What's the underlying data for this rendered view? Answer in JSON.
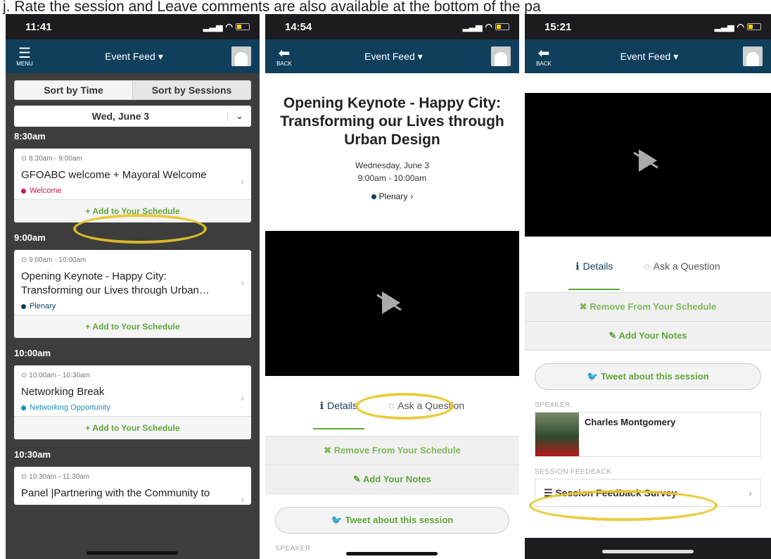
{
  "caption": "j.   Rate the session and Leave comments are also available at the bottom of the pa",
  "phone1": {
    "time": "11:41",
    "nav": {
      "left_label": "MENU",
      "title": "Event Feed"
    },
    "sort_time": "Sort by Time",
    "sort_sessions": "Sort by Sessions",
    "date": "Wed, June 3",
    "groups": [
      {
        "time": "8:30am",
        "sessions": [
          {
            "time": "8:30am - 9:00am",
            "title": "GFOABC welcome + Mayoral Welcome",
            "tag": "Welcome",
            "tag_color": "#c8185c",
            "add": "Add to Your Schedule"
          }
        ]
      },
      {
        "time": "9:00am",
        "sessions": [
          {
            "time": "9:00am - 10:00am",
            "title": "Opening Keynote - Happy City: Transforming our Lives through Urban…",
            "tag": "Plenary",
            "tag_color": "#103f5c",
            "add": "Add to Your Schedule"
          }
        ]
      },
      {
        "time": "10:00am",
        "sessions": [
          {
            "time": "10:00am - 10:30am",
            "title": "Networking Break",
            "tag": "Networking Opportunity",
            "tag_color": "#1e8fb4",
            "add": "Add to Your Schedule"
          }
        ]
      },
      {
        "time": "10:30am",
        "sessions": [
          {
            "time": "10:30am - 11:30am",
            "title": "Panel |Partnering with the Community to"
          }
        ]
      }
    ]
  },
  "phone2": {
    "time": "14:54",
    "nav": {
      "left_label": "BACK",
      "title": "Event Feed"
    },
    "title": "Opening Keynote - Happy City: Transforming our Lives through Urban Design",
    "date": "Wednesday, June 3",
    "hours": "9:00am - 10:00am",
    "track": "Plenary",
    "tab_details": "Details",
    "tab_ask": "Ask a Question",
    "remove": "Remove From Your Schedule",
    "notes": "Add Your Notes",
    "tweet": "Tweet about this session",
    "speaker_label": "SPEAKER"
  },
  "phone3": {
    "time": "15:21",
    "nav": {
      "left_label": "BACK",
      "title": "Event Feed"
    },
    "tab_details": "Details",
    "tab_ask": "Ask a Question",
    "remove": "Remove From Your Schedule",
    "notes": "Add Your Notes",
    "tweet": "Tweet about this session",
    "speaker_label": "SPEAKER",
    "speaker_name": "Charles Montgomery",
    "feedback_label": "SESSION FEEDBACK",
    "survey": "Session Feedback Survey"
  },
  "colors": {
    "nav": "#103f5c",
    "accent_green": "#5fa73a",
    "highlight": "#e9c52a"
  }
}
